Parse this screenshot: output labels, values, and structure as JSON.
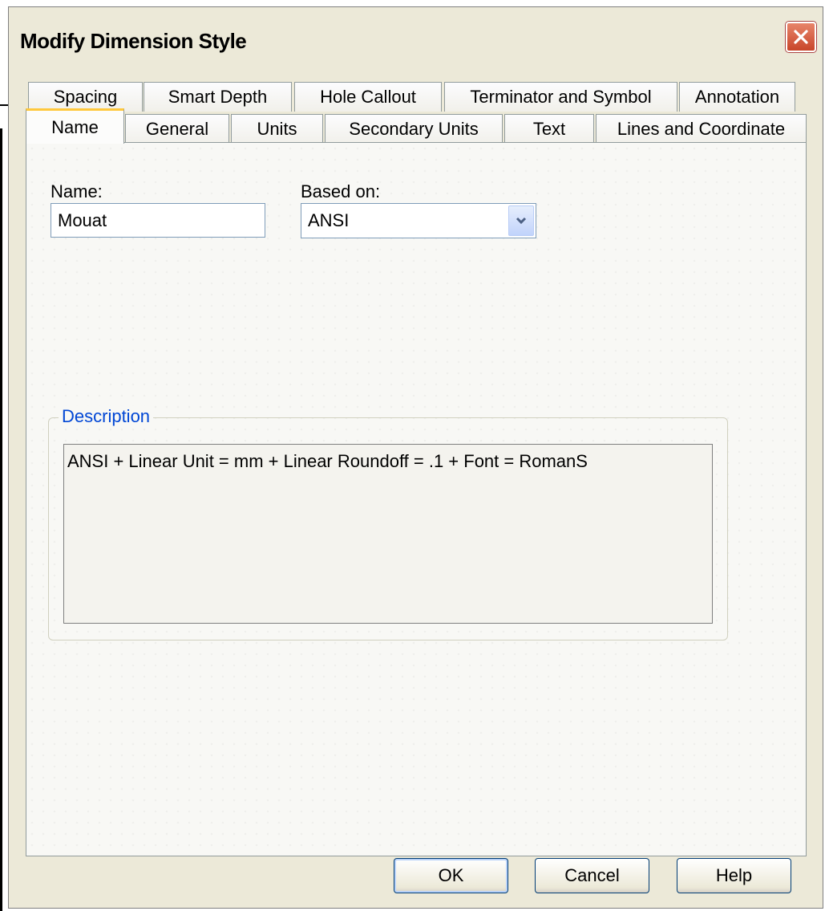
{
  "window": {
    "title": "Modify Dimension Style"
  },
  "tabs_row1": [
    {
      "label": "Spacing"
    },
    {
      "label": "Smart Depth"
    },
    {
      "label": "Hole Callout"
    },
    {
      "label": "Terminator and Symbol"
    },
    {
      "label": "Annotation"
    }
  ],
  "tabs_row2": [
    {
      "label": "Name",
      "active": true
    },
    {
      "label": "General"
    },
    {
      "label": "Units"
    },
    {
      "label": "Secondary Units"
    },
    {
      "label": "Text"
    },
    {
      "label": "Lines and Coordinate"
    }
  ],
  "form": {
    "name_label": "Name:",
    "name_value": "Mouat",
    "based_on_label": "Based on:",
    "based_on_value": "ANSI"
  },
  "description": {
    "title": "Description",
    "text": "ANSI + Linear Unit = mm + Linear Roundoff = .1 + Font = RomanS"
  },
  "buttons": {
    "ok": "OK",
    "cancel": "Cancel",
    "help": "Help"
  },
  "colors": {
    "dialog_bg": "#ece9d8",
    "active_tab_accent": "#ffc83c",
    "group_title": "#0046d5",
    "close_button": "#c8452a"
  }
}
